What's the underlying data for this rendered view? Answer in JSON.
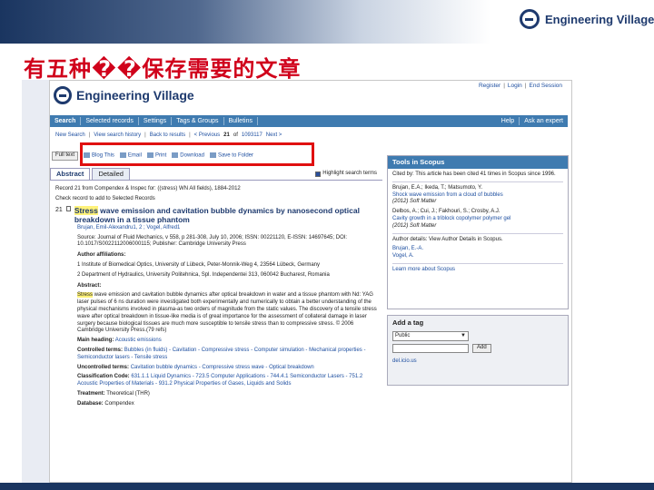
{
  "slide": {
    "title": "有五种��保存需要的文章",
    "logo_text": "Engineering Village"
  },
  "ev": {
    "logo_text": "Engineering Village",
    "top_links": [
      "Register",
      "Login",
      "End Session"
    ],
    "nav_left": [
      "Search",
      "Selected records",
      "Settings",
      "Tags & Groups",
      "Bulletins"
    ],
    "nav_right": [
      "Help",
      "Ask an expert"
    ],
    "toolbar1": {
      "new_search": "New Search",
      "view_history": "View search history",
      "back": "Back to results",
      "previous": "< Previous",
      "position": "21",
      "of": "of",
      "total": "1093117",
      "next": "Next >"
    },
    "toolbar2": {
      "full_text": "Full text",
      "blog": "Blog This",
      "email": "Email",
      "print": "Print",
      "download": "Download",
      "folder": "Save to Folder"
    },
    "tabs": [
      "Abstract",
      "Detailed"
    ],
    "highlight_label": "Highlight search terms"
  },
  "record": {
    "meta": "Record 21 from Compendex & Inspec for: ((stress) WN All fields), 1884-2012",
    "check_hint": "Check record to add to Selected Records",
    "number": "21",
    "title_hl": "Stress",
    "title_rest": " wave emission and cavitation bubble dynamics by nanosecond optical breakdown in a tissue phantom",
    "authors": "Brujan, Emil-Alexandru1, 2 ; Vogel, Alfred1",
    "source": "Source: Journal of Fluid Mechanics, v 558, p 281-308, July 10, 2006; ISSN: 00221120, E-ISSN: 14697645; DOI: 10.1017/S0022112006000115; Publisher: Cambridge University Press",
    "affil_label": "Author affiliations:",
    "affil1": "1 Institute of Biomedical Optics, University of Lübeck, Peter-Monnik-Weg 4, 23564 Lübeck, Germany",
    "affil2": "2 Department of Hydraulics, University Politehnica, Spl. Independentei 313, 060042 Bucharest, Romania",
    "abstract_label": "Abstract:",
    "abstract_hl": "Stress",
    "abstract_text": " wave emission and cavitation bubble dynamics after optical breakdown in water and a tissue phantom with Nd: YAG laser pulses of 6 ns duration were investigated both experimentally and numerically to obtain a better understanding of the physical mechanisms involved in plasma-as two orders of magnitude from the static values. The discovery of a tensile stress wave after optical breakdown in tissue-like media is of great importance for the assessment of collateral damage in laser surgery because biological tissues are much more susceptible to tensile stress than to compressive stress. © 2006 Cambridge University Press.(79 refs)",
    "heading_label": "Main heading:",
    "heading": "Acoustic emissions",
    "controlled_label": "Controlled terms:",
    "controlled": "Bubbles (in fluids) - Cavitation - Compressive stress - Computer simulation - Mechanical properties - Semiconductor lasers - Tensile stress",
    "uncontrolled_label": "Uncontrolled terms:",
    "uncontrolled": "Cavitation bubble dynamics - Compressive stress wave - Optical breakdown",
    "class_label": "Classification Code:",
    "class": "631.1.1 Liquid Dynamics - 723.5 Computer Applications - 744.4.1 Semiconductor Lasers - 751.2 Acoustic Properties of Materials - 931.2 Physical Properties of Gases, Liquids and Solids",
    "treatment_label": "Treatment:",
    "treatment": "Theoretical (THR)",
    "database_label": "Database:",
    "database": "Compendex"
  },
  "scopus": {
    "title": "Tools in Scopus",
    "cited": "Cited by: This article has been cited 41 times in Scopus since 1996.",
    "ref1_authors": "Brujan, E.A.; Ikeda, T.; Matsumoto, Y.",
    "ref1_title": "Shock wave emission from a cloud of bubbles",
    "ref1_source": "(2012) Soft Matter",
    "ref2_authors": "Delbos, A.; Cui, J.; Fakhouri, S.; Crosby, A.J.",
    "ref2_title": "Cavity growth in a triblock copolymer polymer gel",
    "ref2_source": "(2012) Soft Matter",
    "author_details": "Author details: View Author Details in Scopus.",
    "author1": "Brujan, E.-A.",
    "author2": "Vogel, A.",
    "learn_more": "Learn more about Scopus"
  },
  "tag": {
    "title": "Add a tag",
    "visibility": "Public",
    "add": "Add",
    "delicious": "del.icio.us"
  }
}
